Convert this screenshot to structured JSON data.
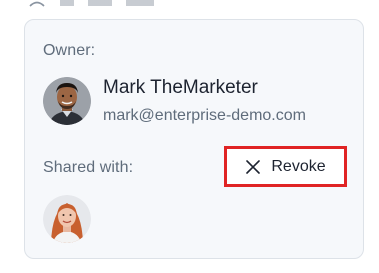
{
  "card": {
    "owner_label": "Owner:",
    "owner": {
      "name": "Mark TheMarketer",
      "email": "mark@enterprise-demo.com",
      "avatar_icon": "avatar-man-icon"
    },
    "shared_with_label": "Shared with:",
    "revoke": {
      "label": "Revoke",
      "icon": "close-icon",
      "highlight_color": "#e02424"
    },
    "shared_users": [
      {
        "avatar_icon": "avatar-woman-icon"
      }
    ]
  },
  "colors": {
    "card_background": "#f6f8fb",
    "card_border": "#dde2e8",
    "label_text": "#5f6c7b",
    "primary_text": "#1d2330"
  }
}
